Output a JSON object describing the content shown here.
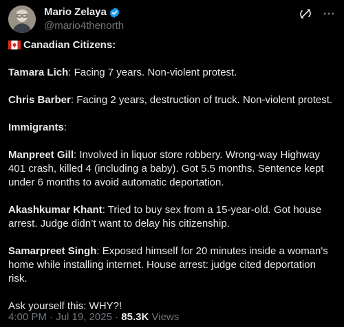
{
  "author": {
    "display_name": "Mario Zelaya",
    "handle": "@mario4thenorth",
    "avatar_icon": "avatar-photo",
    "verified": true,
    "verified_color": "#1d9bf0"
  },
  "header_icons": [
    "grok-icon",
    "more-icon"
  ],
  "post": {
    "heading_label": "Canadian Citizens:",
    "heading_flag_icon": "canada-flag-icon",
    "items": [
      {
        "name": "Tamara Lich",
        "text": ": Facing 7 years. Non-violent protest."
      },
      {
        "name": "Chris Barber",
        "text": ": Facing 2 years, destruction of truck. Non-violent protest."
      }
    ],
    "section2_label": "Immigrants",
    "section2_colon": ":",
    "items2": [
      {
        "name": "Manpreet Gill",
        "text": ": Involved in liquor store robbery. Wrong-way Highway 401 crash, killed 4 (including a baby). Got 5.5 months. Sentence kept under 6 months to avoid automatic deportation."
      },
      {
        "name": "Akashkumar Khant",
        "text": ": Tried to buy sex from a 15-year-old. Got house arrest. Judge didn’t want to delay his citizenship."
      },
      {
        "name": "Samarpreet Singh",
        "text": ": Exposed himself for 20 minutes inside a woman's home while installing internet. House arrest: judge cited deportation risk."
      }
    ],
    "closing": "Ask yourself this: WHY?!"
  },
  "meta": {
    "time": "4:00 PM",
    "separator": "·",
    "date": "Jul 19, 2025",
    "views_count": "85.3K",
    "views_label": "Views"
  },
  "colors": {
    "background": "#000000",
    "text": "#e7e9ea",
    "secondary": "#71767b"
  }
}
